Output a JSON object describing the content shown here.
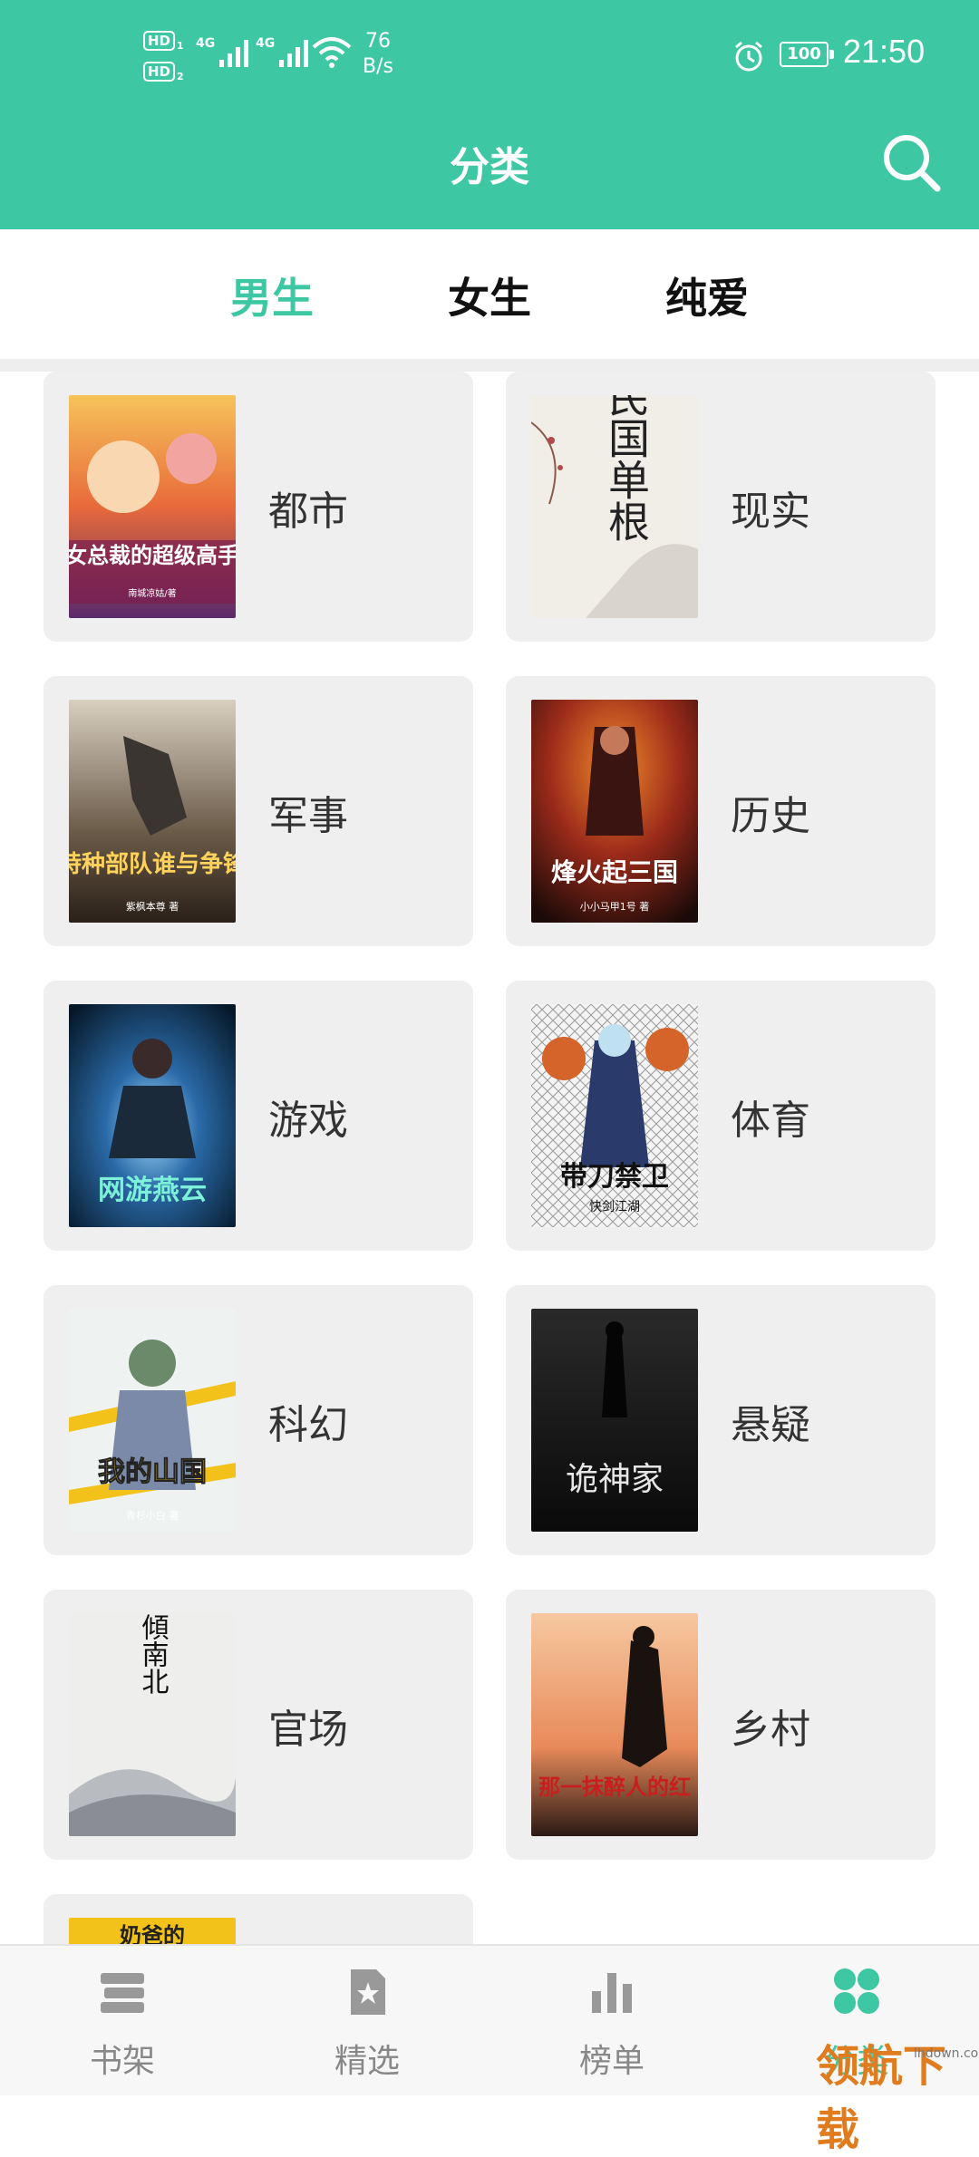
{
  "status_bar": {
    "sim1": "HD",
    "sim1_index": "1",
    "sim2": "HD",
    "sim2_index": "2",
    "net1": "4G",
    "net2": "4G",
    "speed_value": "76",
    "speed_unit": "B/s",
    "battery": "100",
    "time": "21:50"
  },
  "header": {
    "title": "分类"
  },
  "tabs": [
    {
      "label": "男生",
      "active": true
    },
    {
      "label": "女生",
      "active": false
    },
    {
      "label": "纯爱",
      "active": false
    }
  ],
  "categories": [
    {
      "label": "都市",
      "cover_title": "女总裁的超级高手",
      "cover_author": "南城凉姑/著"
    },
    {
      "label": "现实",
      "cover_title": "民国单根",
      "cover_author": ""
    },
    {
      "label": "军事",
      "cover_title": "特种部队谁与争锋",
      "cover_author": "紫枫本尊 著"
    },
    {
      "label": "历史",
      "cover_title": "烽火起三国",
      "cover_author": "小小马甲1号 著"
    },
    {
      "label": "游戏",
      "cover_title": "网游燕云",
      "cover_author": ""
    },
    {
      "label": "体育",
      "cover_title": "带刀禁卫",
      "cover_author": "快剑江湖"
    },
    {
      "label": "科幻",
      "cover_title": "我的山国",
      "cover_author": "青衫小白 著"
    },
    {
      "label": "悬疑",
      "cover_title": "诡神家",
      "cover_author": ""
    },
    {
      "label": "官场",
      "cover_title": "權傾南北",
      "cover_author": ""
    },
    {
      "label": "乡村",
      "cover_title": "那一抹醉人的红",
      "cover_author": ""
    },
    {
      "label": "",
      "cover_title": "奶爸的",
      "cover_author": ""
    }
  ],
  "bottom_nav": [
    {
      "label": "书架",
      "icon": "bookshelf-icon",
      "active": false
    },
    {
      "label": "精选",
      "icon": "star-book-icon",
      "active": false
    },
    {
      "label": "榜单",
      "icon": "bar-chart-icon",
      "active": false
    },
    {
      "label": "分类",
      "icon": "category-icon",
      "active": true
    }
  ],
  "watermark": {
    "text": "领航下载",
    "sub": "lhdown.com"
  },
  "colors": {
    "accent": "#3ec7a3",
    "card_bg": "#efefef",
    "text": "#333333"
  }
}
